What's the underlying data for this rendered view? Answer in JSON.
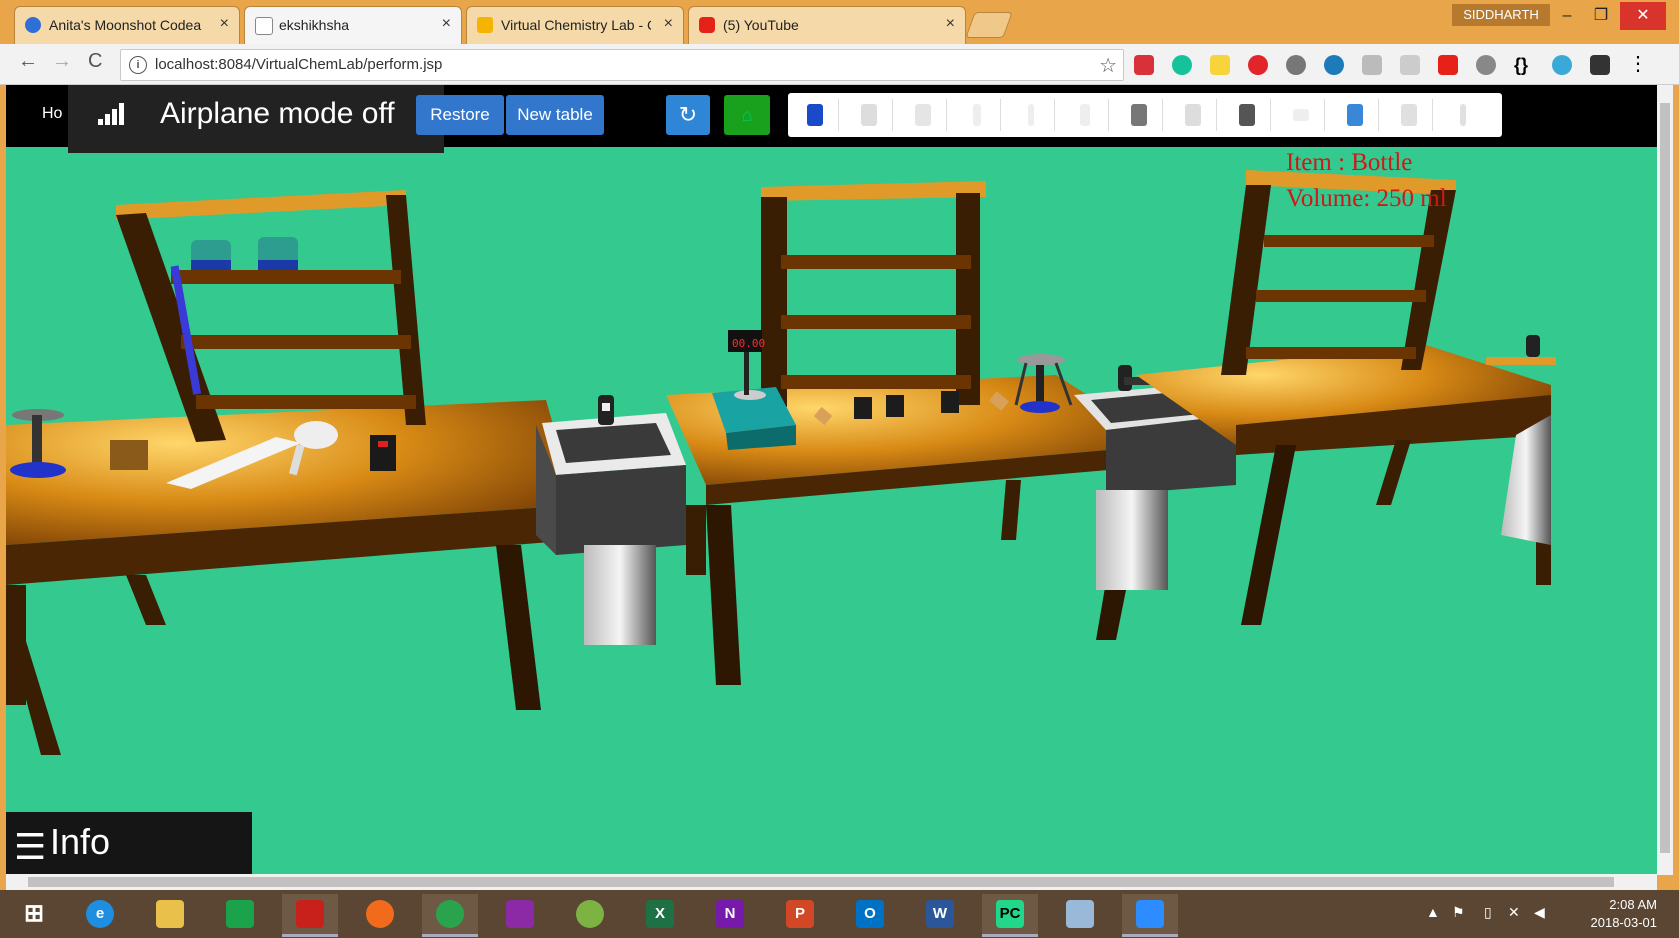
{
  "browser": {
    "tabs": [
      {
        "title": "Anita's Moonshot Codea",
        "favicon": "rocket-icon",
        "active": false
      },
      {
        "title": "ekshikhsha",
        "favicon": "chart-icon",
        "active": true
      },
      {
        "title": "Virtual Chemistry Lab - C",
        "favicon": "slides-icon",
        "active": false
      },
      {
        "title": "(5) YouTube",
        "favicon": "youtube-icon",
        "active": false
      }
    ],
    "close_glyph": "×",
    "profile_name": "SIDDHARTH",
    "url": "localhost:8084/VirtualChemLab/perform.jsp",
    "info_glyph": "i",
    "star_glyph": "☆",
    "back_glyph": "←",
    "forward_glyph": "→",
    "reload_glyph": "C",
    "min_glyph": "–",
    "restore_glyph": "❐",
    "winclose_glyph": "✕"
  },
  "app": {
    "home_label": "Ho",
    "toast_text": "Airplane mode off",
    "restore_label": "Restore",
    "new_table_label": "New table",
    "undo_glyph": "↻",
    "apparatus_items": [
      "bottle",
      "beaker",
      "flask",
      "test-tube",
      "burette",
      "cylinder",
      "crucible",
      "funnel",
      "burner",
      "dish",
      "dropper",
      "tripod",
      "thermometer"
    ],
    "item_label": "Item : Bottle",
    "volume_label": "Volume: 250 ml",
    "scale_readout": "00.00",
    "info_label": "Info",
    "info_glyph": "☰"
  },
  "taskbar": {
    "apps": [
      "windows-start-icon",
      "internet-explorer-icon",
      "file-explorer-icon",
      "store-icon",
      "acrobat-icon",
      "firefox-icon",
      "chrome-icon",
      "winrar-icon",
      "android-studio-icon",
      "excel-icon",
      "onenote-icon",
      "powerpoint-icon",
      "outlook-icon",
      "word-icon",
      "pycharm-icon",
      "virtualbox-icon",
      "zoom-icon"
    ],
    "time": "2:08 AM",
    "date": "2018-03-01"
  }
}
